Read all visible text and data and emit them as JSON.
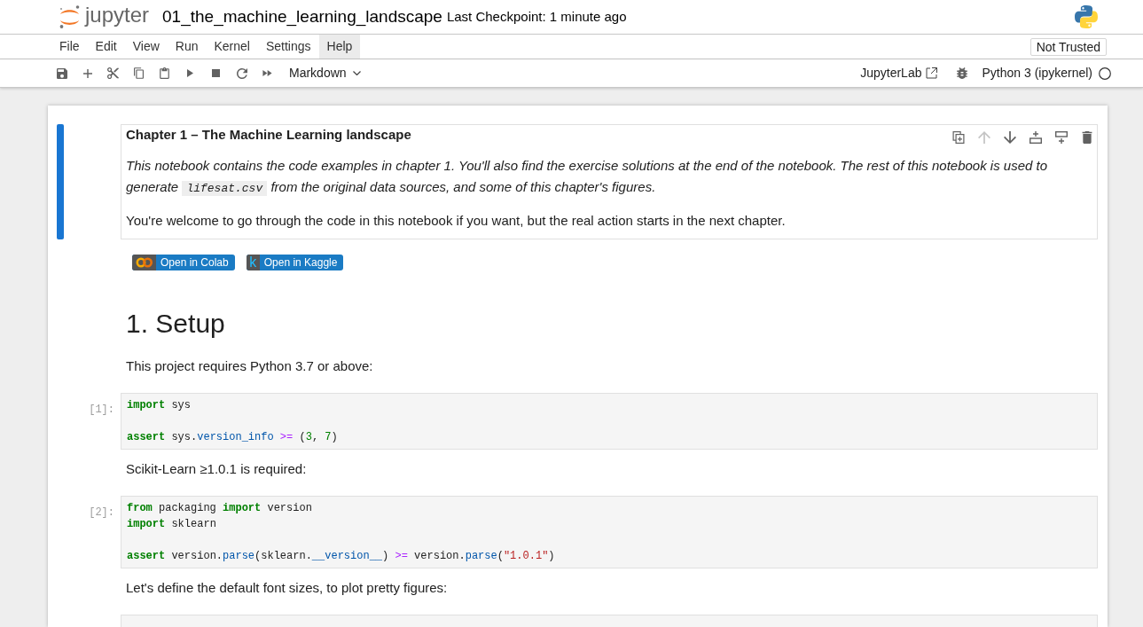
{
  "header": {
    "logo_text": "jupyter",
    "notebook_title": "01_the_machine_learning_landscape",
    "checkpoint": "Last Checkpoint: 1 minute ago"
  },
  "menu": [
    {
      "label": "File",
      "selected": false
    },
    {
      "label": "Edit",
      "selected": false
    },
    {
      "label": "View",
      "selected": false
    },
    {
      "label": "Run",
      "selected": false
    },
    {
      "label": "Kernel",
      "selected": false
    },
    {
      "label": "Settings",
      "selected": false
    },
    {
      "label": "Help",
      "selected": true
    }
  ],
  "trust_button": {
    "label": "Not Trusted"
  },
  "toolbar": {
    "cell_type": "Markdown",
    "link": "JupyterLab",
    "kernel": "Python 3 (ipykernel)",
    "kernel_busy": false
  },
  "cells": [
    {
      "kind": "markdown",
      "selected": true,
      "cell_toolbar": [
        {
          "kind": "duplicate",
          "disabled": false
        },
        {
          "kind": "move_up",
          "disabled": true
        },
        {
          "kind": "move_down",
          "disabled": false
        },
        {
          "kind": "insert_above",
          "disabled": false
        },
        {
          "kind": "insert_below",
          "disabled": false
        },
        {
          "kind": "delete",
          "disabled": false
        }
      ],
      "blocks": [
        {
          "kind": "strong",
          "text": "Chapter 1 – The Machine Learning landscape"
        },
        {
          "kind": "emphasis",
          "parts": [
            {
              "kind": "text",
              "text": "This notebook contains the code examples in chapter 1. You'll also find the exercise solutions at the end of the notebook. The rest of this notebook is used to generate "
            },
            {
              "kind": "code",
              "text": "lifesat.csv"
            },
            {
              "kind": "text",
              "text": " from the original data sources, and some of this chapter's figures."
            }
          ]
        },
        {
          "kind": "paragraph",
          "text": "You're welcome to go through the code in this notebook if you want, but the real action starts in the next chapter."
        }
      ]
    },
    {
      "kind": "markdown",
      "selected": false,
      "blocks": [
        {
          "kind": "badges",
          "items": [
            {
              "kind": "rings",
              "label": "Open in Colab"
            },
            {
              "kind": "letter",
              "logo_text": "k",
              "label": "Open in Kaggle"
            }
          ]
        }
      ]
    },
    {
      "kind": "markdown",
      "selected": false,
      "blocks": [
        {
          "kind": "heading",
          "text": "1. Setup"
        }
      ]
    },
    {
      "kind": "markdown",
      "selected": false,
      "blocks": [
        {
          "kind": "paragraph",
          "text": "This project requires Python 3.7 or above:"
        }
      ]
    },
    {
      "kind": "code",
      "selected": false,
      "prompt": "[1]:",
      "lines": [
        {
          "kind": "code",
          "tokens": [
            {
              "kind": "keyword",
              "text": "import"
            },
            {
              "kind": "plain",
              "text": " sys"
            }
          ]
        },
        {
          "kind": "blank"
        },
        {
          "kind": "code",
          "tokens": [
            {
              "kind": "keyword",
              "text": "assert"
            },
            {
              "kind": "plain",
              "text": " sys."
            },
            {
              "kind": "attribute",
              "text": "version_info"
            },
            {
              "kind": "operator",
              "text": " >= "
            },
            {
              "kind": "plain",
              "text": "("
            },
            {
              "kind": "number",
              "text": "3"
            },
            {
              "kind": "plain",
              "text": ", "
            },
            {
              "kind": "number",
              "text": "7"
            },
            {
              "kind": "plain",
              "text": ")"
            }
          ]
        }
      ]
    },
    {
      "kind": "markdown",
      "selected": false,
      "blocks": [
        {
          "kind": "paragraph",
          "text": "Scikit-Learn ≥1.0.1 is required:"
        }
      ]
    },
    {
      "kind": "code",
      "selected": false,
      "prompt": "[2]:",
      "lines": [
        {
          "kind": "code",
          "tokens": [
            {
              "kind": "keyword",
              "text": "from"
            },
            {
              "kind": "plain",
              "text": " packaging "
            },
            {
              "kind": "keyword",
              "text": "import"
            },
            {
              "kind": "plain",
              "text": " version"
            }
          ]
        },
        {
          "kind": "code",
          "tokens": [
            {
              "kind": "keyword",
              "text": "import"
            },
            {
              "kind": "plain",
              "text": " sklearn"
            }
          ]
        },
        {
          "kind": "blank"
        },
        {
          "kind": "code",
          "tokens": [
            {
              "kind": "keyword",
              "text": "assert"
            },
            {
              "kind": "plain",
              "text": " version."
            },
            {
              "kind": "attribute",
              "text": "parse"
            },
            {
              "kind": "plain",
              "text": "(sklearn."
            },
            {
              "kind": "attribute",
              "text": "__version__"
            },
            {
              "kind": "plain",
              "text": ")"
            },
            {
              "kind": "operator",
              "text": " >= "
            },
            {
              "kind": "plain",
              "text": "version."
            },
            {
              "kind": "attribute",
              "text": "parse"
            },
            {
              "kind": "plain",
              "text": "("
            },
            {
              "kind": "string",
              "text": "\"1.0.1\""
            },
            {
              "kind": "plain",
              "text": ")"
            }
          ]
        }
      ]
    },
    {
      "kind": "markdown",
      "selected": false,
      "blocks": [
        {
          "kind": "paragraph",
          "text": "Let's define the default font sizes, to plot pretty figures:"
        }
      ]
    },
    {
      "kind": "code",
      "selected": false
    }
  ]
}
